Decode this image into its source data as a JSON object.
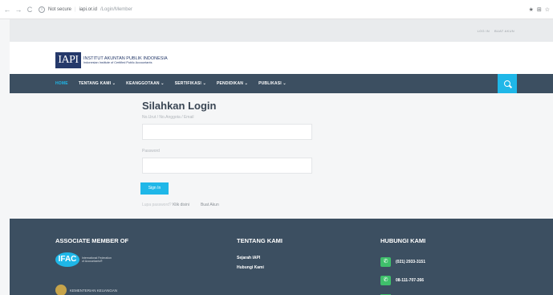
{
  "browser": {
    "back": "←",
    "forward": "→",
    "reload": "C",
    "security_label": "Not secure",
    "url_host": "iapi.or.id",
    "url_path": "/Login/Member",
    "right_icons": [
      "★",
      "⊞",
      "☆"
    ]
  },
  "util": {
    "links": [
      "LOG IN",
      "BUAT AKUN"
    ]
  },
  "logo": {
    "mark": "IAPI",
    "name": "INSTITUT AKUNTAN PUBLIK INDONESIA",
    "subtitle": "Indonesian Institute of Certified Public Accountants"
  },
  "nav": {
    "items": [
      {
        "label": "HOME",
        "active": true
      },
      {
        "label": "TENTANG KAMI ⌄",
        "active": false
      },
      {
        "label": "KEANGGOTAAN ⌄",
        "active": false
      },
      {
        "label": "SERTIFIKASI ⌄",
        "active": false
      },
      {
        "label": "PENDIDIKAN ⌄",
        "active": false
      },
      {
        "label": "PUBLIKASI ⌄",
        "active": false
      }
    ],
    "search_icon": "search-icon"
  },
  "login": {
    "title": "Silahkan Login",
    "username_label": "No.Urut / No.Anggota / Email",
    "username_value": "",
    "password_label": "Password",
    "password_value": "",
    "signin_label": "Sign In",
    "forgot_label": "Lupa password?",
    "klik_label": "Klik disini",
    "create_label": "Buat Akun"
  },
  "footer": {
    "associate_heading": "ASSOCIATE MEMBER OF",
    "ifac_mark": "IFAC",
    "ifac_text": "International Federation of Accountants®",
    "kemenkeu_text": "KEMENTERIAN KEUANGAN",
    "about_heading": "TENTANG KAMI",
    "about_links": [
      "Sejarah IAPI",
      "Hubungi Kami"
    ],
    "contact_heading": "HUBUNGI KAMI",
    "contacts": [
      {
        "icon": "phone-icon",
        "text": "(021) 2933-3151"
      },
      {
        "icon": "whatsapp-icon",
        "text": "08-111-707-266"
      }
    ]
  },
  "colors": {
    "nav_bg": "#3c4f61",
    "accent": "#1fb7e8",
    "logo_blue": "#25396a",
    "contact_green": "#3fbf6b"
  }
}
